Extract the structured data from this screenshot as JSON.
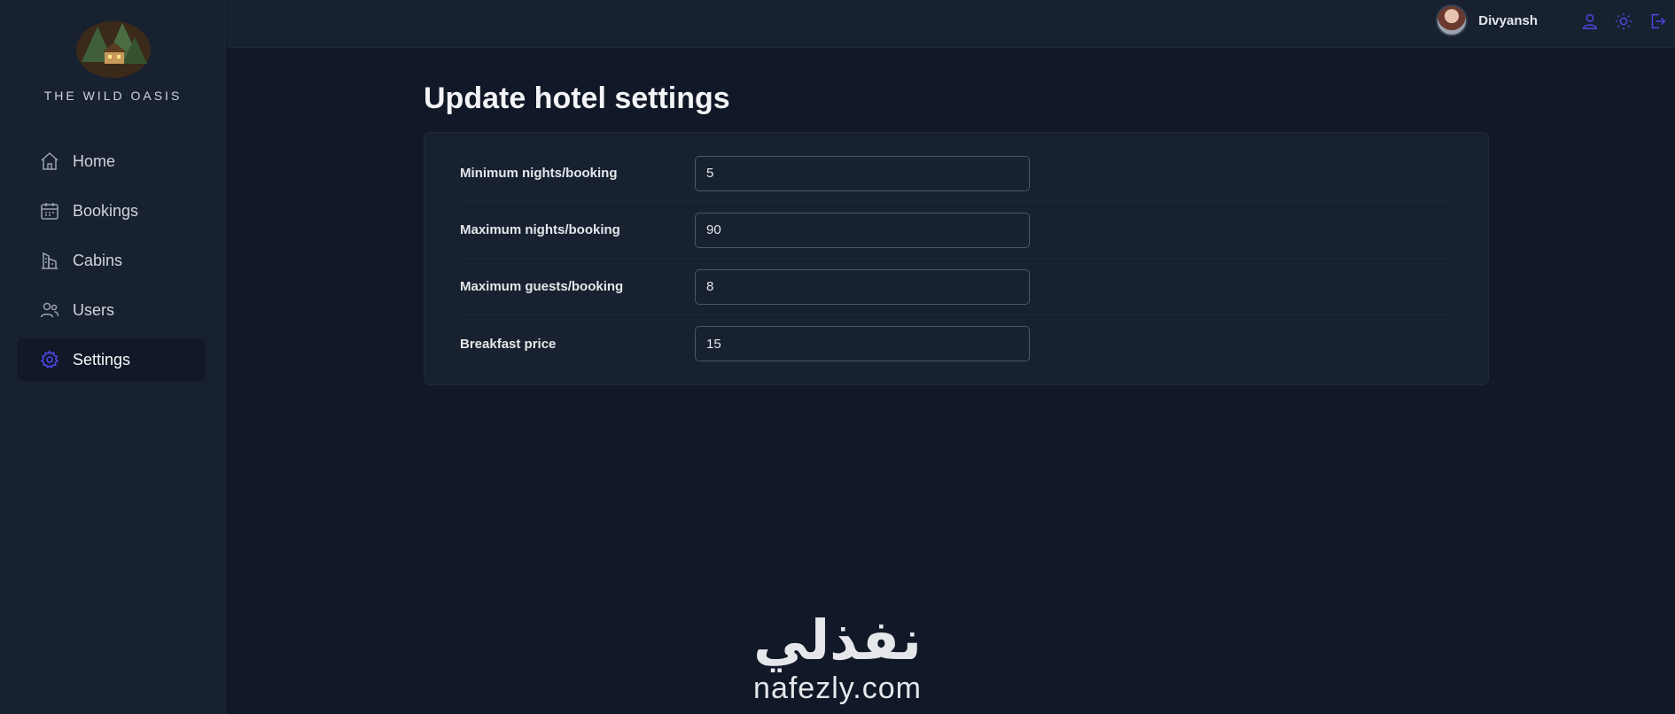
{
  "app": {
    "logo_text": "THE WILD OASIS"
  },
  "sidebar": {
    "items": [
      {
        "label": "Home",
        "icon": "home-icon",
        "active": false
      },
      {
        "label": "Bookings",
        "icon": "calendar-icon",
        "active": false
      },
      {
        "label": "Cabins",
        "icon": "building-icon",
        "active": false
      },
      {
        "label": "Users",
        "icon": "users-icon",
        "active": false
      },
      {
        "label": "Settings",
        "icon": "gear-icon",
        "active": true
      }
    ]
  },
  "header": {
    "user_name": "Divyansh",
    "actions": [
      "user-icon",
      "sun-icon",
      "logout-icon"
    ]
  },
  "main": {
    "title": "Update hotel settings",
    "fields": [
      {
        "label": "Minimum nights/booking",
        "value": "5"
      },
      {
        "label": "Maximum nights/booking",
        "value": "90"
      },
      {
        "label": "Maximum guests/booking",
        "value": "8"
      },
      {
        "label": "Breakfast price",
        "value": "15"
      }
    ]
  },
  "watermark": {
    "arabic": "نفذلي",
    "latin": "nafezly.com"
  },
  "colors": {
    "accent": "#4f46e5",
    "background": "#111827",
    "panel": "#18212f"
  }
}
